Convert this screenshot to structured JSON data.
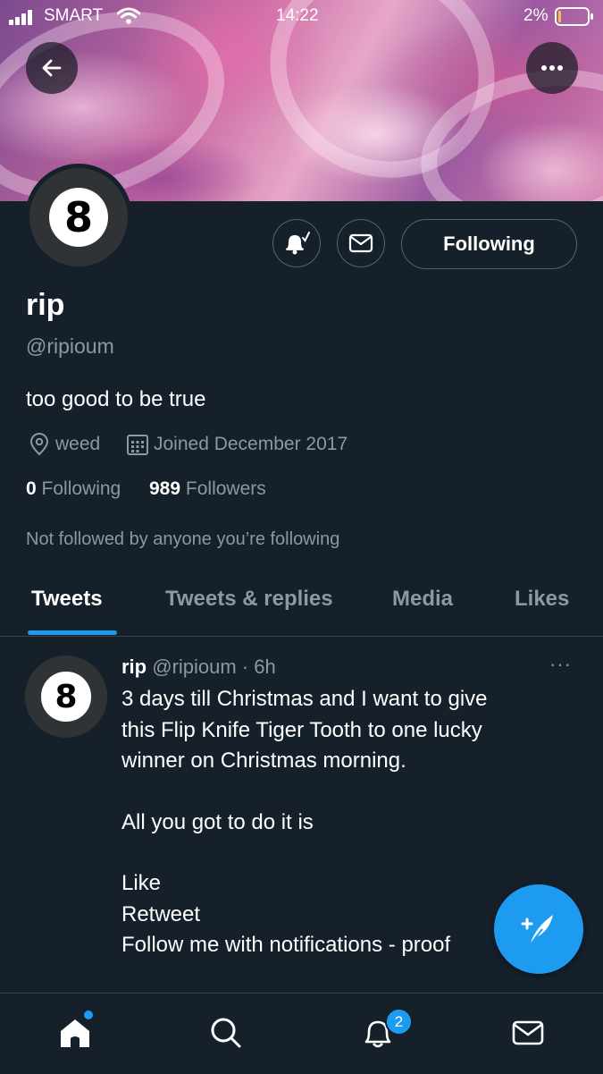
{
  "status_bar": {
    "carrier": "SMART",
    "time": "14:22",
    "battery_percent": "2%"
  },
  "profile": {
    "display_name": "rip",
    "handle": "@ripioum",
    "bio": "too good to be true",
    "location": "weed",
    "joined": "Joined December 2017",
    "following_count": "0",
    "following_label": "Following",
    "followers_count": "989",
    "followers_label": "Followers",
    "not_followed_text": "Not followed by anyone you’re following",
    "avatar_glyph": "8",
    "follow_button_label": "Following"
  },
  "tabs": [
    {
      "label": "Tweets",
      "active": true
    },
    {
      "label": "Tweets & replies",
      "active": false
    },
    {
      "label": "Media",
      "active": false
    },
    {
      "label": "Likes",
      "active": false
    }
  ],
  "tweet": {
    "author_name": "rip",
    "author_handle": "@ripioum",
    "separator": "·",
    "time_ago": "6h",
    "more_label": "···",
    "lines": {
      "line1": "3 days till Christmas and I want to give",
      "line2": "this Flip Knife Tiger Tooth to one lucky",
      "line3": "winner on Christmas morning.",
      "line4": "All you got to do it is",
      "line5": "Like",
      "line6": "Retweet",
      "line7": "Follow me with notifications - proof"
    }
  },
  "bottom_nav": {
    "notifications_badge": "2",
    "items": [
      "home-icon",
      "search-icon",
      "bell-icon",
      "mail-icon"
    ]
  },
  "colors": {
    "background": "#15202b",
    "accent": "#1d9bf0",
    "secondary_text": "#8b98a5",
    "divider": "#38444d"
  }
}
